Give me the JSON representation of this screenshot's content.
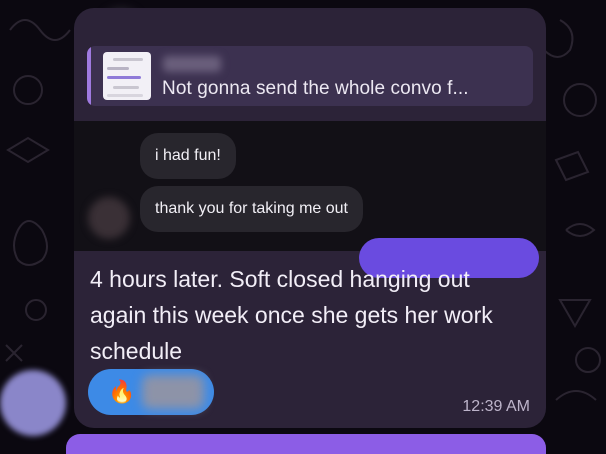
{
  "reply_preview": {
    "quoted_text": "Not gonna send the whole convo f...",
    "accent_color": "#9f7ae0"
  },
  "embedded_screenshot": {
    "messages": [
      {
        "text": "i had fun!"
      },
      {
        "text": "thank you for taking me out"
      }
    ]
  },
  "message": {
    "caption": "4 hours later. Soft closed hanging out again this week once she gets her work schedule",
    "time": "12:39 AM"
  },
  "reaction": {
    "emoji": "🔥",
    "color": "#3d8ae6"
  },
  "colors": {
    "bubble": "#2c2338",
    "background": "#0b0810",
    "outgoing_bubble": "#8c5de6"
  }
}
